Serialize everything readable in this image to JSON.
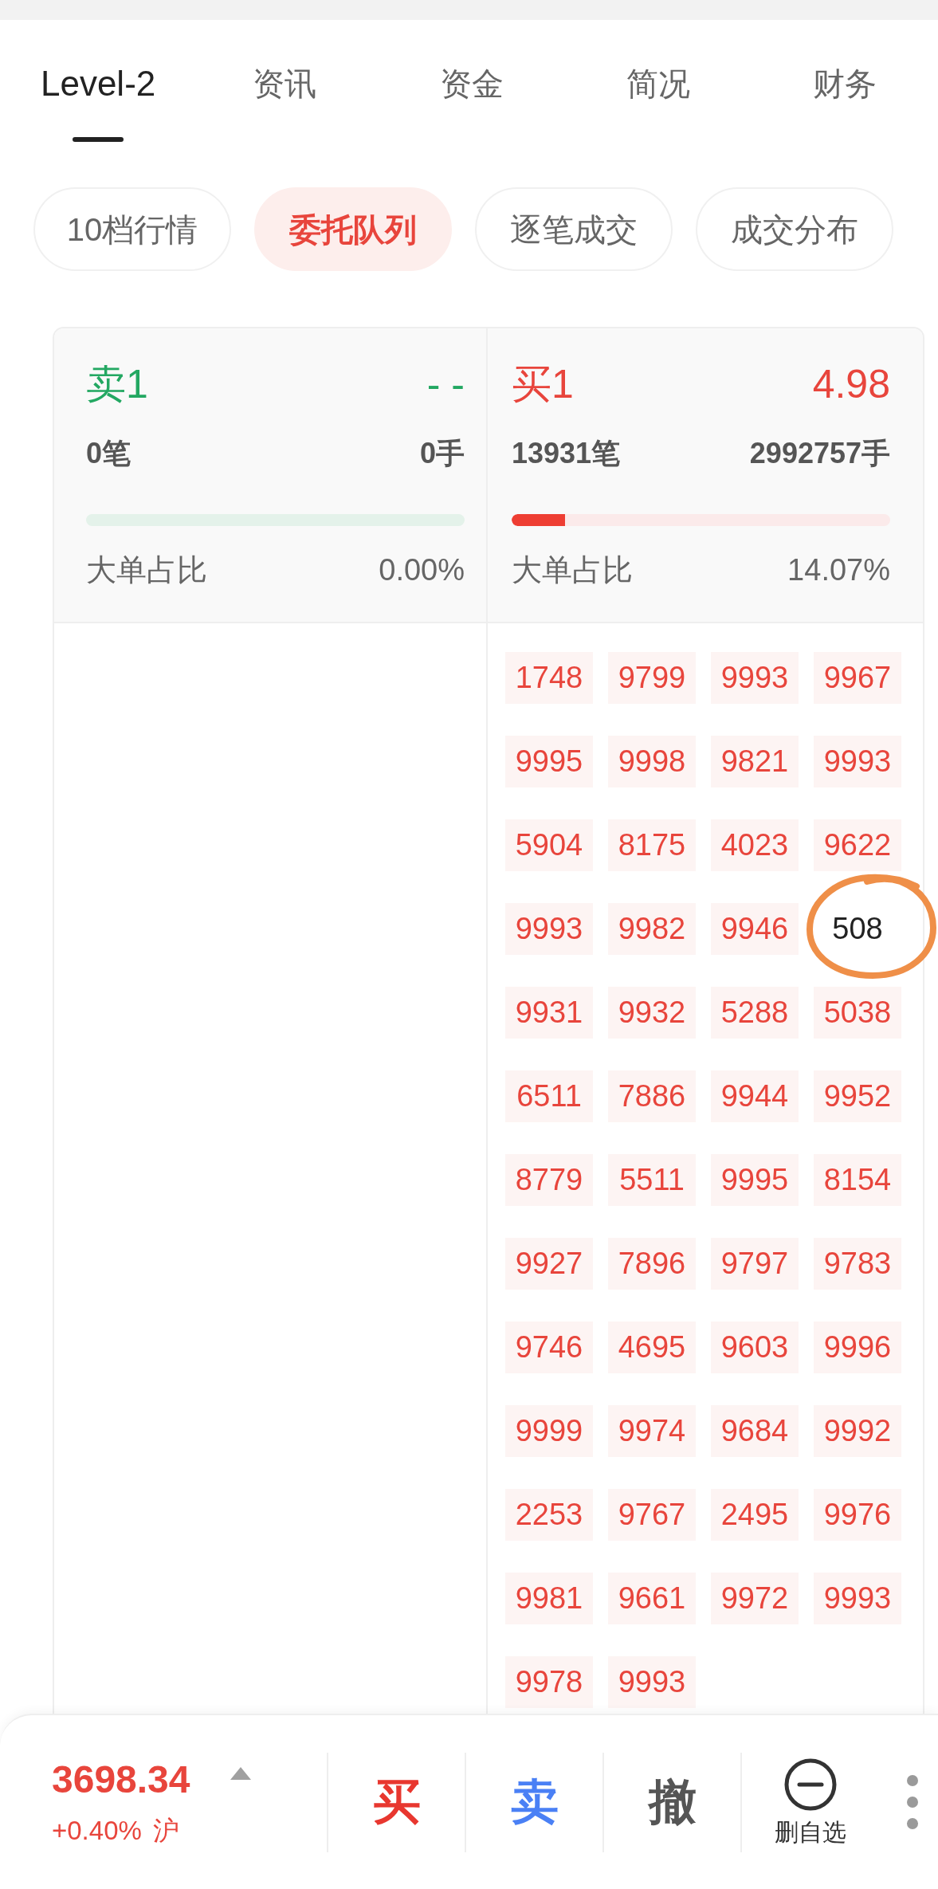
{
  "tabs": [
    {
      "label": "Level-2",
      "selected": true
    },
    {
      "label": "资讯",
      "selected": false
    },
    {
      "label": "资金",
      "selected": false
    },
    {
      "label": "简况",
      "selected": false
    },
    {
      "label": "财务",
      "selected": false
    }
  ],
  "sub_tabs": [
    {
      "label": "10档行情",
      "selected": false
    },
    {
      "label": "委托队列",
      "selected": true
    },
    {
      "label": "逐笔成交",
      "selected": false
    },
    {
      "label": "成交分布",
      "selected": false
    }
  ],
  "order_book": {
    "sides": [
      {
        "kind": "sell",
        "label": "卖1",
        "price": "- -",
        "orders": "0笔",
        "lots": "0手",
        "ratio_label": "大单占比",
        "ratio": "0.00%"
      },
      {
        "kind": "buy",
        "label": "买1",
        "price": "4.98",
        "orders": "13931笔",
        "lots": "2992757手",
        "level": 0.14,
        "ratio_label": "大单占比",
        "ratio": "14.07%",
        "queue": [
          {
            "value": "1748",
            "highlighted": true
          },
          {
            "value": "9799",
            "highlighted": true
          },
          {
            "value": "9993",
            "highlighted": true
          },
          {
            "value": "9967",
            "highlighted": true
          },
          {
            "value": "9995",
            "highlighted": true
          },
          {
            "value": "9998",
            "highlighted": true
          },
          {
            "value": "9821",
            "highlighted": true
          },
          {
            "value": "9993",
            "highlighted": true
          },
          {
            "value": "5904",
            "highlighted": true
          },
          {
            "value": "8175",
            "highlighted": true
          },
          {
            "value": "4023",
            "highlighted": true
          },
          {
            "value": "9622",
            "highlighted": true
          },
          {
            "value": "9993",
            "highlighted": true
          },
          {
            "value": "9982",
            "highlighted": true
          },
          {
            "value": "9946",
            "highlighted": true
          },
          {
            "value": "508",
            "highlighted": false
          },
          {
            "value": "9931",
            "highlighted": true
          },
          {
            "value": "9932",
            "highlighted": true
          },
          {
            "value": "5288",
            "highlighted": true
          },
          {
            "value": "5038",
            "highlighted": true
          },
          {
            "value": "6511",
            "highlighted": true
          },
          {
            "value": "7886",
            "highlighted": true
          },
          {
            "value": "9944",
            "highlighted": true
          },
          {
            "value": "9952",
            "highlighted": true
          },
          {
            "value": "8779",
            "highlighted": true
          },
          {
            "value": "5511",
            "highlighted": true
          },
          {
            "value": "9995",
            "highlighted": true
          },
          {
            "value": "8154",
            "highlighted": true
          },
          {
            "value": "9927",
            "highlighted": true
          },
          {
            "value": "7896",
            "highlighted": true
          },
          {
            "value": "9797",
            "highlighted": true
          },
          {
            "value": "9783",
            "highlighted": true
          },
          {
            "value": "9746",
            "highlighted": true
          },
          {
            "value": "4695",
            "highlighted": true
          },
          {
            "value": "9603",
            "highlighted": true
          },
          {
            "value": "9996",
            "highlighted": true
          },
          {
            "value": "9999",
            "highlighted": true
          },
          {
            "value": "9974",
            "highlighted": true
          },
          {
            "value": "9684",
            "highlighted": true
          },
          {
            "value": "9992",
            "highlighted": true
          },
          {
            "value": "2253",
            "highlighted": true
          },
          {
            "value": "9767",
            "highlighted": true
          },
          {
            "value": "2495",
            "highlighted": true
          },
          {
            "value": "9976",
            "highlighted": true
          },
          {
            "value": "9981",
            "highlighted": true
          },
          {
            "value": "9661",
            "highlighted": true
          },
          {
            "value": "9972",
            "highlighted": true
          },
          {
            "value": "9993",
            "highlighted": true
          },
          {
            "value": "9978",
            "highlighted": true
          },
          {
            "value": "9993",
            "highlighted": true
          }
        ]
      }
    ]
  },
  "bottom_bar": {
    "index": {
      "price": "3698.34",
      "change": "+0.40%",
      "market": "沪"
    },
    "actions": [
      {
        "kind": "buy",
        "label": "买"
      },
      {
        "kind": "sell",
        "label": "卖"
      },
      {
        "kind": "cancel",
        "label": "撤"
      }
    ],
    "watchlist": {
      "label": "删自选"
    }
  }
}
